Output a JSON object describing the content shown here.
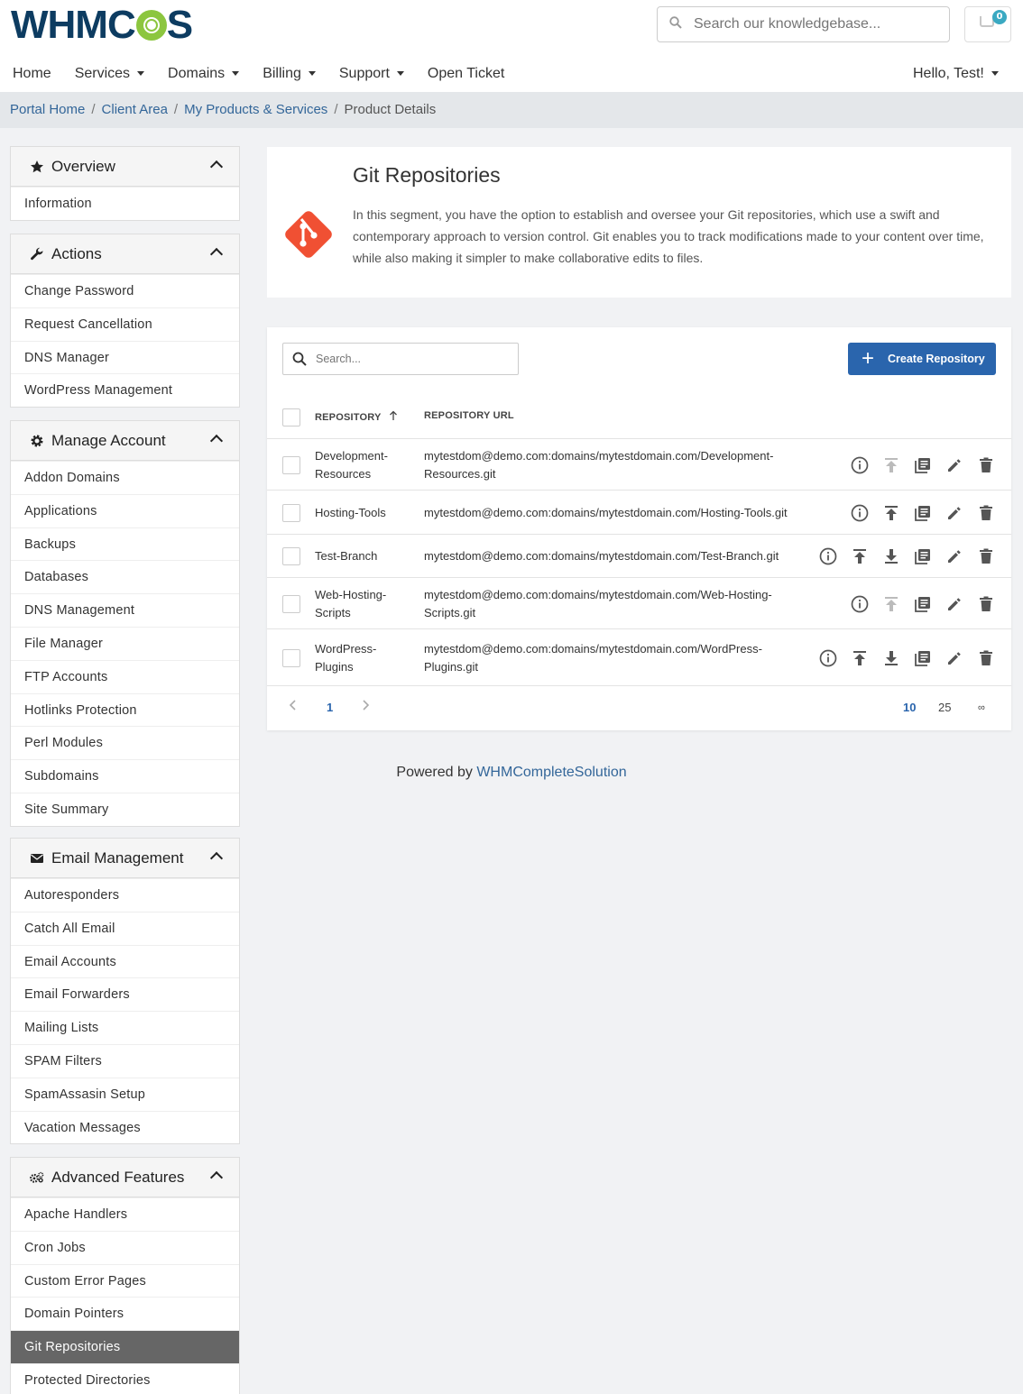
{
  "brand": {
    "logo_left": "WHM",
    "logo_right": "S",
    "accent": "#8cc63f",
    "navy": "#0d3c61"
  },
  "header": {
    "search_placeholder": "Search our knowledgebase...",
    "cart_count": "0",
    "nav": [
      "Home",
      "Services",
      "Domains",
      "Billing",
      "Support",
      "Open Ticket"
    ],
    "nav_dropdown": [
      false,
      true,
      true,
      true,
      true,
      false
    ],
    "user_menu": "Hello, Test!"
  },
  "breadcrumb": {
    "items": [
      "Portal Home",
      "Client Area",
      "My Products & Services"
    ],
    "current": "Product Details",
    "separator": "/"
  },
  "sidebar": {
    "panels": [
      {
        "title": "Overview",
        "icon": "star-icon",
        "items": [
          "Information"
        ]
      },
      {
        "title": "Actions",
        "icon": "wrench-icon",
        "items": [
          "Change Password",
          "Request Cancellation",
          "DNS Manager",
          "WordPress Management"
        ]
      },
      {
        "title": "Manage Account",
        "icon": "gear-icon",
        "items": [
          "Addon Domains",
          "Applications",
          "Backups",
          "Databases",
          "DNS Management",
          "File Manager",
          "FTP Accounts",
          "Hotlinks Protection",
          "Perl Modules",
          "Subdomains",
          "Site Summary"
        ]
      },
      {
        "title": "Email Management",
        "icon": "envelope-icon",
        "items": [
          "Autoresponders",
          "Catch All Email",
          "Email Accounts",
          "Email Forwarders",
          "Mailing Lists",
          "SPAM Filters",
          "SpamAssasin Setup",
          "Vacation Messages"
        ]
      },
      {
        "title": "Advanced Features",
        "icon": "gears-icon",
        "items": [
          "Apache Handlers",
          "Cron Jobs",
          "Custom Error Pages",
          "Domain Pointers",
          "Git Repositories",
          "Protected Directories"
        ],
        "active": "Git Repositories"
      }
    ]
  },
  "hero": {
    "title": "Git Repositories",
    "description": "In this segment, you have the option to establish and oversee your Git repositories, which use a swift and contemporary approach to version control. Git enables you to track modifications made to your content over time, while also making it simpler to make collaborative edits to files.",
    "icon": "git-logo-icon",
    "icon_color": "#f05033"
  },
  "repos": {
    "search_placeholder": "Search...",
    "create_label": "Create Repository",
    "col_repository": "REPOSITORY",
    "col_url": "REPOSITORY URL",
    "sort": "ascending",
    "rows": [
      {
        "name": "Development-Resources",
        "url": "mytestdom@demo.com:domains/mytestdomain.com/Development-Resources.git",
        "has_pull": false,
        "push_enabled": false
      },
      {
        "name": "Hosting-Tools",
        "url": "mytestdom@demo.com:domains/mytestdomain.com/Hosting-Tools.git",
        "has_pull": false,
        "push_enabled": true
      },
      {
        "name": "Test-Branch",
        "url": "mytestdom@demo.com:domains/mytestdomain.com/Test-Branch.git",
        "has_pull": true,
        "push_enabled": true
      },
      {
        "name": "Web-Hosting-Scripts",
        "url": "mytestdom@demo.com:domains/mytestdomain.com/Web-Hosting-Scripts.git",
        "has_pull": false,
        "push_enabled": false
      },
      {
        "name": "WordPress-Plugins",
        "url": "mytestdom@demo.com:domains/mytestdomain.com/WordPress-Plugins.git",
        "has_pull": true,
        "push_enabled": true
      }
    ],
    "pager": {
      "current_page": "1",
      "page_sizes": [
        "10",
        "25",
        "∞"
      ],
      "selected_size": "10"
    }
  },
  "footer": {
    "prefix": "Powered by ",
    "link": "WHMCompleteSolution"
  }
}
